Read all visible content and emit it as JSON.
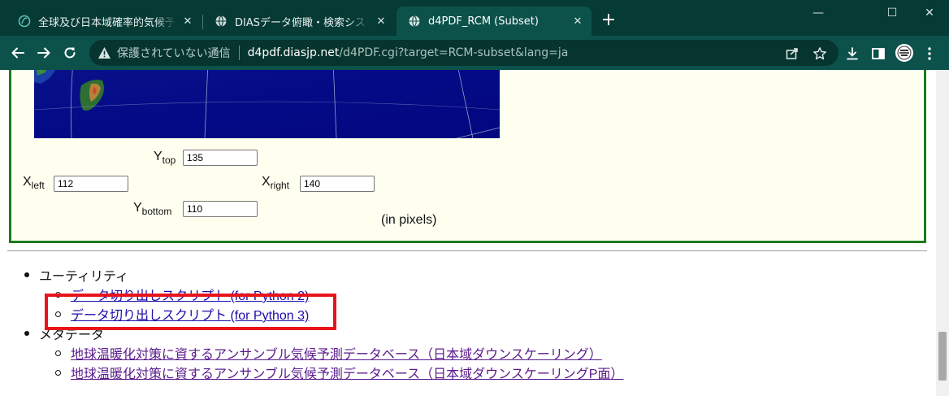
{
  "browser": {
    "tabs": [
      {
        "title": "全球及び日本域確率的気候予測デ",
        "icon": "globe-leaf-icon",
        "active": false
      },
      {
        "title": "DIASデータ俯瞰・検索システム",
        "icon": "globe-icon",
        "active": false
      },
      {
        "title": "d4PDF_RCM (Subset)",
        "icon": "globe-icon",
        "active": true
      }
    ],
    "new_tab": "+",
    "window_controls": {
      "minimize": "—",
      "maximize": "☐",
      "close": "✕"
    },
    "omnibox": {
      "security_label": "保護されていない通信",
      "host": "d4pdf.diasjp.net",
      "path": "/d4PDF.cgi?target=RCM-subset&lang=ja"
    }
  },
  "page": {
    "coords": {
      "ytop_label": "Y",
      "ytop_sub": "top",
      "ytop_value": "135",
      "xleft_label": "X",
      "xleft_sub": "left",
      "xleft_value": "112",
      "xright_label": "X",
      "xright_sub": "right",
      "xright_value": "140",
      "ybottom_label": "Y",
      "ybottom_sub": "bottom",
      "ybottom_value": "110",
      "unit_note": "(in pixels)"
    },
    "sections": {
      "utility": {
        "heading": "ユーティリティ",
        "links": [
          "データ切り出しスクリプト (for Python 2)",
          "データ切り出しスクリプト (for Python 3)"
        ]
      },
      "metadata": {
        "heading": "メタデータ",
        "links": [
          "地球温暖化対策に資するアンサンブル気候予測データベース（日本域ダウンスケーリング）",
          "地球温暖化対策に資するアンサンブル気候予測データベース（日本域ダウンスケーリングP面）"
        ]
      }
    }
  },
  "colors": {
    "tabstrip": "#063a34",
    "toolbar": "#0c524b",
    "panel_border": "#1e7a1e",
    "panel_bg": "#fffff0",
    "highlight": "#e8141b",
    "link": "#1a0dab",
    "visited_link": "#5a1a8c"
  }
}
